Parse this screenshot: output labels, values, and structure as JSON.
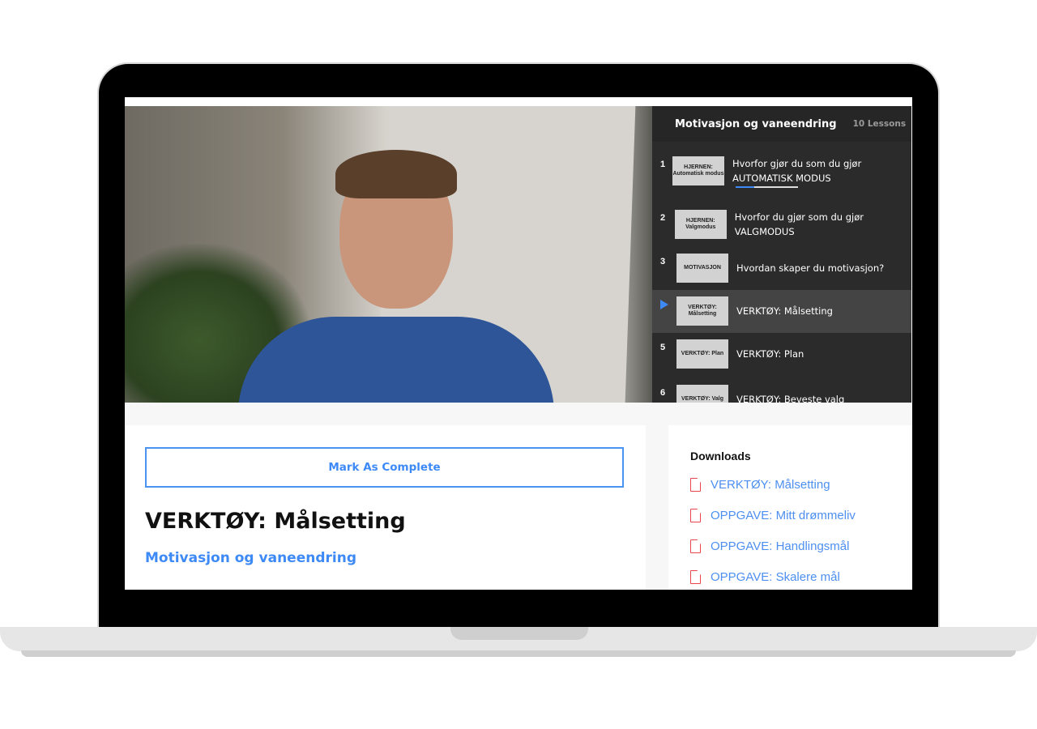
{
  "playlist": {
    "title": "Motivasjon og vaneendring",
    "count": "10 Lessons",
    "lessons": [
      {
        "num": "1",
        "thumb": "HJERNEN: Automatisk modus",
        "title": "Hvorfor gjør du som du gjør AUTOMATISK MODUS",
        "progress": 0.3
      },
      {
        "num": "2",
        "thumb": "HJERNEN: Valgmodus",
        "title": "Hvorfor du gjør som du gjør VALGMODUS"
      },
      {
        "num": "3",
        "thumb": "MOTIVASJON",
        "title": "Hvordan skaper du motivasjon?"
      },
      {
        "num": "4",
        "thumb": "VERKTØY: Målsetting",
        "title": "VERKTØY: Målsetting",
        "active": true
      },
      {
        "num": "5",
        "thumb": "VERKTØY: Plan",
        "title": "VERKTØY: Plan"
      },
      {
        "num": "6",
        "thumb": "VERKTØY: Valg",
        "title": "VERKTØY: Beveste valg"
      }
    ]
  },
  "main": {
    "mark_complete": "Mark As Complete",
    "lesson_title": "VERKTØY: Målsetting",
    "course": "Motivasjon og vaneendring"
  },
  "downloads": {
    "heading": "Downloads",
    "items": [
      "VERKTØY: Målsetting",
      "OPPGAVE: Mitt drømmeliv",
      "OPPGAVE: Handlingsmål",
      "OPPGAVE: Skalere mål"
    ]
  },
  "colors": {
    "accent": "#3d8af7",
    "pdf": "#e8454d",
    "sidebar": "#2b2b2b"
  }
}
